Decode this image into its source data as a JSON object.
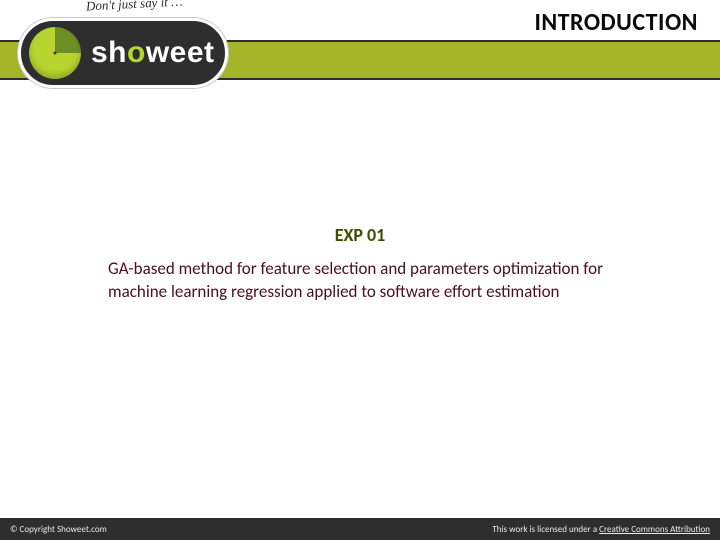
{
  "header": {
    "title": "INTRODUCTION"
  },
  "logo": {
    "tagline": "Don't just say it …",
    "word_left": "sh",
    "word_mid": "o",
    "word_right": "weet"
  },
  "content": {
    "exp_label": "EXP 01",
    "body": "GA-based method for feature selection and parameters optimization for machine learning regression applied to software effort estimation"
  },
  "footer": {
    "copyright": "© Copyright Showeet.com",
    "license_prefix": "This work is licensed under a ",
    "license_link": "Creative Commons Attribution"
  }
}
